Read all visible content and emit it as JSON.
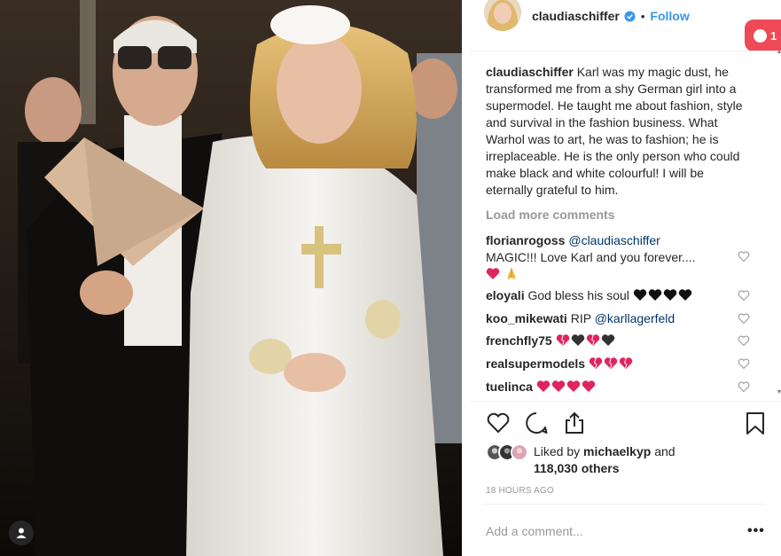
{
  "post": {
    "username": "claudiaschiffer",
    "follow_label": "Follow",
    "separator": "•",
    "notification_count": "1"
  },
  "caption": {
    "username": "claudiaschiffer",
    "text": "Karl was my magic dust, he transformed me from a shy German girl into a supermodel. He taught me about fashion, style and survival in the fashion business. What Warhol was to art, he was to fashion; he is irreplaceable. He is the only person who could make black and white colourful! I will be eternally grateful to him."
  },
  "load_more": "Load more comments",
  "comments": [
    {
      "user": "florianrogoss",
      "mention": "@claudiaschiffer",
      "text": "MAGIC!!! Love Karl and you forever....",
      "emoji": [
        "red-heart",
        "folded-hands"
      ]
    },
    {
      "user": "eloyali",
      "text": "God bless his soul",
      "emoji": [
        "black-heart",
        "black-heart",
        "black-heart",
        "black-heart"
      ]
    },
    {
      "user": "koo_mikewati",
      "text": "RIP",
      "mention": "@karllagerfeld"
    },
    {
      "user": "frenchfly75",
      "emoji": [
        "broken-heart",
        "black-heart",
        "broken-heart",
        "black-heart"
      ]
    },
    {
      "user": "realsupermodels",
      "emoji": [
        "broken-heart",
        "broken-heart",
        "broken-heart"
      ]
    },
    {
      "user": "tuelinca",
      "emoji": [
        "red-heart",
        "red-heart",
        "red-heart",
        "red-heart"
      ]
    }
  ],
  "likes": {
    "prefix": "Liked by",
    "user": "michaelkyp",
    "and": "and",
    "count": "118,030 others"
  },
  "time_ago": "18 HOURS AGO",
  "add_comment_placeholder": "Add a comment...",
  "more_label": "•••",
  "colors": {
    "link": "#3897f0",
    "mention": "#003569",
    "muted": "#999999",
    "notification": "#ed4956",
    "heart_red": "#e0245e"
  },
  "icons": [
    "verified-icon",
    "heart-icon",
    "comment-icon",
    "share-icon",
    "bookmark-icon",
    "user-tag-icon",
    "comment-like-heart-icon"
  ]
}
